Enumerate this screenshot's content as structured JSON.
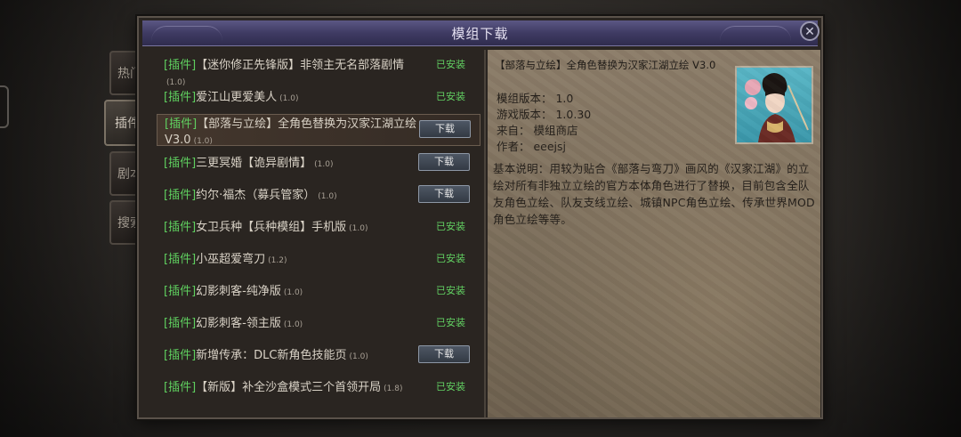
{
  "dialog": {
    "title": "模组下载"
  },
  "side_tabs": [
    {
      "label": "热门",
      "active": false
    },
    {
      "label": "插件",
      "active": true
    },
    {
      "label": "剧本",
      "active": false
    },
    {
      "label": "搜索",
      "active": false
    }
  ],
  "mods": [
    {
      "tag": "[插件]",
      "name": "【迷你修正先锋版】非领主无名部落剧情",
      "version": "(1.0)",
      "status": "已安装",
      "selected": false
    },
    {
      "tag": "[插件]",
      "name": "爱江山更爱美人",
      "version": "(1.0)",
      "status": "已安装",
      "selected": false
    },
    {
      "tag": "[插件]",
      "name": "【部落与立绘】全角色替换为汉家江湖立绘 V3.0",
      "version": "(1.0)",
      "status": "下载",
      "selected": true
    },
    {
      "tag": "[插件]",
      "name": "三更冥婚【诡异剧情】",
      "version": "(1.0)",
      "status": "下载",
      "selected": false
    },
    {
      "tag": "[插件]",
      "name": "约尔·福杰（募兵管家）",
      "version": "(1.0)",
      "status": "下载",
      "selected": false
    },
    {
      "tag": "[插件]",
      "name": "女卫兵种【兵种模组】手机版",
      "version": "(1.0)",
      "status": "已安装",
      "selected": false
    },
    {
      "tag": "[插件]",
      "name": "小巫超爱弯刀",
      "version": "(1.2)",
      "status": "已安装",
      "selected": false
    },
    {
      "tag": "[插件]",
      "name": "幻影刺客-纯净版",
      "version": "(1.0)",
      "status": "已安装",
      "selected": false
    },
    {
      "tag": "[插件]",
      "name": "幻影刺客-领主版",
      "version": "(1.0)",
      "status": "已安装",
      "selected": false
    },
    {
      "tag": "[插件]",
      "name": "新增传承：DLC新角色技能页",
      "version": "(1.0)",
      "status": "下载",
      "selected": false
    },
    {
      "tag": "[插件]",
      "name": "【新版】补全沙盒模式三个首领开局",
      "version": "(1.8)",
      "status": "已安装",
      "selected": false
    }
  ],
  "detail": {
    "title": "【部落与立绘】全角色替换为汉家江湖立绘 V3.0",
    "mod_version": "模组版本： 1.0",
    "game_version": "游戏版本： 1.0.30",
    "source": "来自： 模组商店",
    "author": "作者： eeejsj",
    "description": "基本说明：用较为贴合《部落与弯刀》画风的《汉家江湖》的立绘对所有非独立立绘的官方本体角色进行了替换，目前包含全队友角色立绘、队友支线立绘、城镇NPC角色立绘、传承世界MOD角色立绘等等。"
  },
  "colors": {
    "tag_green": "#5fcf5f",
    "installed_green": "#62d062",
    "title_purple": "#3f3b63"
  }
}
